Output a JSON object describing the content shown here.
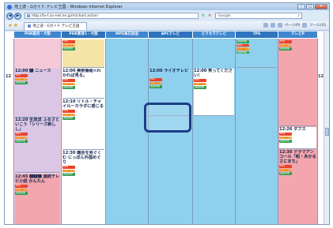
{
  "window": {
    "title": "地上波 - Gガイド.テレビ王国 - Windows Internet Explorer",
    "min_label": "–",
    "max_label": "□",
    "close_label": "✕"
  },
  "nav": {
    "back_label": "◀",
    "forward_label": "▶",
    "address": "http://tv-t.so-net.ne.jp/m/chart.action",
    "refresh_label": "↻",
    "stop_label": "✕",
    "search_placeholder": "Google",
    "search_icon": "search-icon"
  },
  "tabbar": {
    "tab_label": "地上波 - Gガイド.テレビ王国",
    "commands": [
      "ページ(P)",
      "ツール(O)"
    ]
  },
  "channels": [
    {
      "name": "PHK総合・大阪",
      "color": "#3f86cf",
      "bg": "#f3c9d8"
    },
    {
      "name": "PHK教育1・大阪",
      "color": "#2f74bd",
      "bg": "#ffffff"
    },
    {
      "name": "MPS毎日放送",
      "color": "#3f86cf",
      "bg": "#8fd0ee"
    },
    {
      "name": "APCテレビ",
      "color": "#2f74bd",
      "bg": "#8fd0ee"
    },
    {
      "name": "ビクセラテレビ",
      "color": "#3f86cf",
      "bg": "#8fd0ee"
    },
    {
      "name": "TPS",
      "color": "#2f74bd",
      "bg": "#8fd0ee"
    },
    {
      "name": "テレビP",
      "color": "#3f86cf",
      "bg": "#8fd0ee"
    }
  ],
  "hour_label": "12",
  "badges": {
    "epg": "EPG",
    "rec": "リモート予約",
    "detail": "番組詳細"
  },
  "programs": {
    "ch1": [
      {
        "time": "12:00",
        "title": "🅰 ニュース"
      },
      {
        "time": "12:20",
        "title": "生放送 ふるさといこう「シリーズ新しし」"
      },
      {
        "time": "12:45",
        "title": "🅰🅱🅲 連続テレビ小説 かんたん"
      }
    ],
    "ch2": [
      {
        "time": "12:00",
        "title": "美術番組×わかれば見る。"
      },
      {
        "time": "12:10",
        "title": "リトル・チャイルーカラダに感じる"
      },
      {
        "time": "12:30",
        "title": "園芸を完ぐくむ にっぽん外国めぐり"
      }
    ],
    "ch4": [
      {
        "time": "12:00",
        "title": "ライオテレビ"
      }
    ],
    "ch5": [
      {
        "time": "12:00",
        "title": "笑ってください！"
      }
    ],
    "ch7": [
      {
        "time": "12:26",
        "title": "ダブス"
      },
      {
        "time": "12:30",
        "title": "ドラマアンコール「昭・あかるさにまち」"
      }
    ]
  }
}
